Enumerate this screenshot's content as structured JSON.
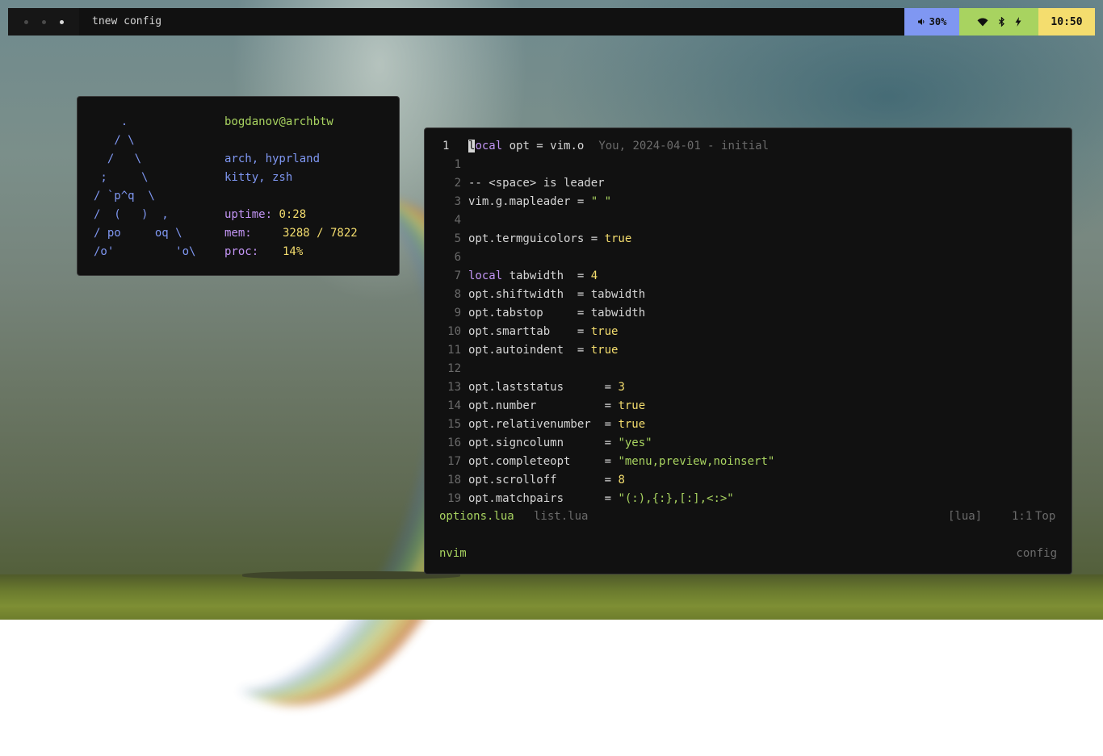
{
  "topbar": {
    "workspaces": 3,
    "window_title": "tnew config",
    "volume_icon": "speaker-icon",
    "volume": "30%",
    "system_icons": [
      "wifi-icon",
      "bluetooth-icon",
      "battery-charging-icon"
    ],
    "clock": "10:50",
    "colors": {
      "volume_bg": "#7f97f2",
      "system_bg": "#a8d360",
      "clock_bg": "#f4dd6e",
      "bar_bg": "#111111"
    }
  },
  "fetch": {
    "ascii": "    .\n   / \\\n  /   \\\n ;     \\\n/ `p^q  \\\n/  (   )  ,\n/ po     oq \\\n/o'         'o\\",
    "user_host": "bogdanov@archbtw",
    "os": "arch, hyprland",
    "apps": "kitty, zsh",
    "uptime_label": "uptime:",
    "uptime": "0:28",
    "mem_label": "mem:",
    "mem": "3288 / 7822",
    "proc_label": "proc:",
    "proc": "14%"
  },
  "editor": {
    "blame": "You, 2024-04-01 - initial",
    "lines": [
      {
        "n": "1",
        "code": "local opt = vim.o"
      },
      {
        "n": "1",
        "code": ""
      },
      {
        "n": "2",
        "code": "-- <space> is leader"
      },
      {
        "n": "3",
        "code": "vim.g.mapleader = \" \""
      },
      {
        "n": "4",
        "code": ""
      },
      {
        "n": "5",
        "code": "opt.termguicolors = true"
      },
      {
        "n": "6",
        "code": ""
      },
      {
        "n": "7",
        "code": "local tabwidth  = 4"
      },
      {
        "n": "8",
        "code": "opt.shiftwidth  = tabwidth"
      },
      {
        "n": "9",
        "code": "opt.tabstop     = tabwidth"
      },
      {
        "n": "10",
        "code": "opt.smarttab    = true"
      },
      {
        "n": "11",
        "code": "opt.autoindent  = true"
      },
      {
        "n": "12",
        "code": ""
      },
      {
        "n": "13",
        "code": "opt.laststatus      = 3"
      },
      {
        "n": "14",
        "code": "opt.number          = true"
      },
      {
        "n": "15",
        "code": "opt.relativenumber  = true"
      },
      {
        "n": "16",
        "code": "opt.signcolumn      = \"yes\""
      },
      {
        "n": "17",
        "code": "opt.completeopt     = \"menu,preview,noinsert\""
      },
      {
        "n": "18",
        "code": "opt.scrolloff       = 8"
      },
      {
        "n": "19",
        "code": "opt.matchpairs      = \"(:),{:},[:],<:>\""
      }
    ],
    "statusline": {
      "active_buffer": "options.lua",
      "inactive_buffer": "list.lua",
      "filetype": "[lua]",
      "position": "1:1",
      "scroll": "Top"
    },
    "tmux": {
      "left": "nvim",
      "right": "config"
    }
  }
}
